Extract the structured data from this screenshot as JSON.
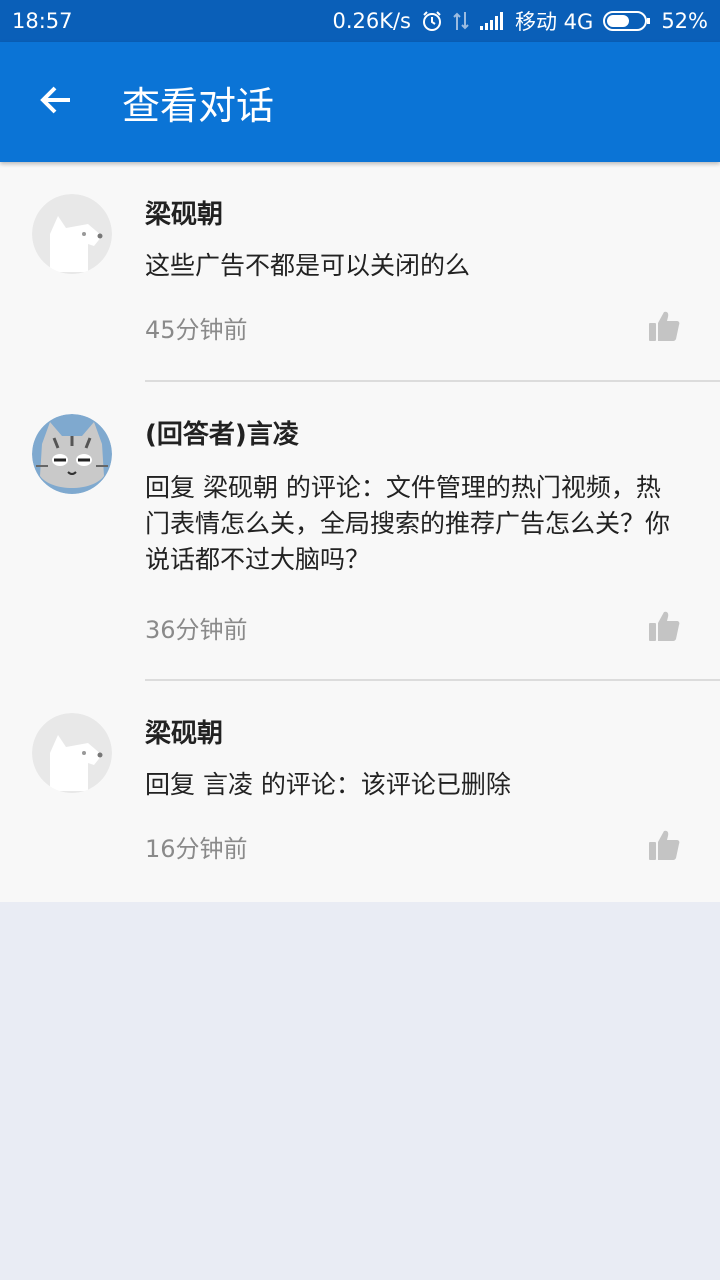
{
  "status_bar": {
    "time": "18:57",
    "speed": "0.26K/s",
    "carrier": "移动 4G",
    "battery": "52%"
  },
  "app_bar": {
    "title": "查看对话",
    "back_icon": "arrow-left-icon"
  },
  "comments": [
    {
      "author": "梁砚朝",
      "text": "这些广告不都是可以关闭的么",
      "time": "45分钟前",
      "avatar": "default-dog-avatar"
    },
    {
      "author": "(回答者)言凌",
      "text": "回复 梁砚朝 的评论：文件管理的热门视频，热门表情怎么关，全局搜索的推荐广告怎么关？你说话都不过大脑吗？",
      "time": "36分钟前",
      "avatar": "cat-avatar"
    },
    {
      "author": "梁砚朝",
      "text": "回复 言凌 的评论：该评论已删除",
      "time": "16分钟前",
      "avatar": "default-dog-avatar"
    }
  ],
  "colors": {
    "status_bar": "#0a5fb8",
    "app_bar": "#0b74d6",
    "list_bg": "#f8f8f8",
    "page_bg": "#e9ecf4"
  }
}
